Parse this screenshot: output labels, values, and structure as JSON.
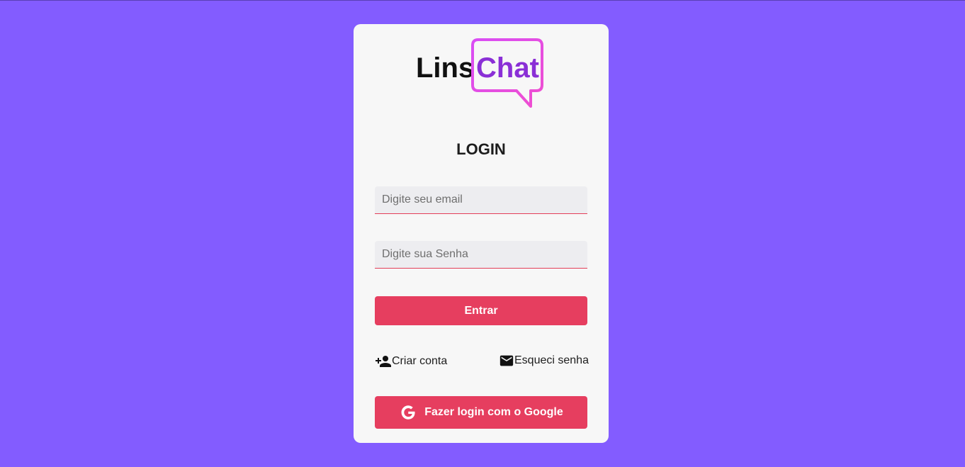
{
  "colors": {
    "background": "#835cff",
    "card": "#f7f7f7",
    "accent": "#e63e5f",
    "logo_purple": "#8a2fd6"
  },
  "logo": {
    "word1": "Lins",
    "word2": "Chat"
  },
  "title": "LOGIN",
  "form": {
    "email_placeholder": "Digite seu email",
    "password_placeholder": "Digite sua Senha",
    "submit_label": "Entrar"
  },
  "links": {
    "create_account": {
      "label": "Criar conta",
      "icon": "person-add-icon"
    },
    "forgot_password": {
      "label": "Esqueci senha",
      "icon": "mail-icon"
    }
  },
  "google_button": {
    "label": "Fazer login com o Google",
    "icon": "google-g-icon"
  }
}
